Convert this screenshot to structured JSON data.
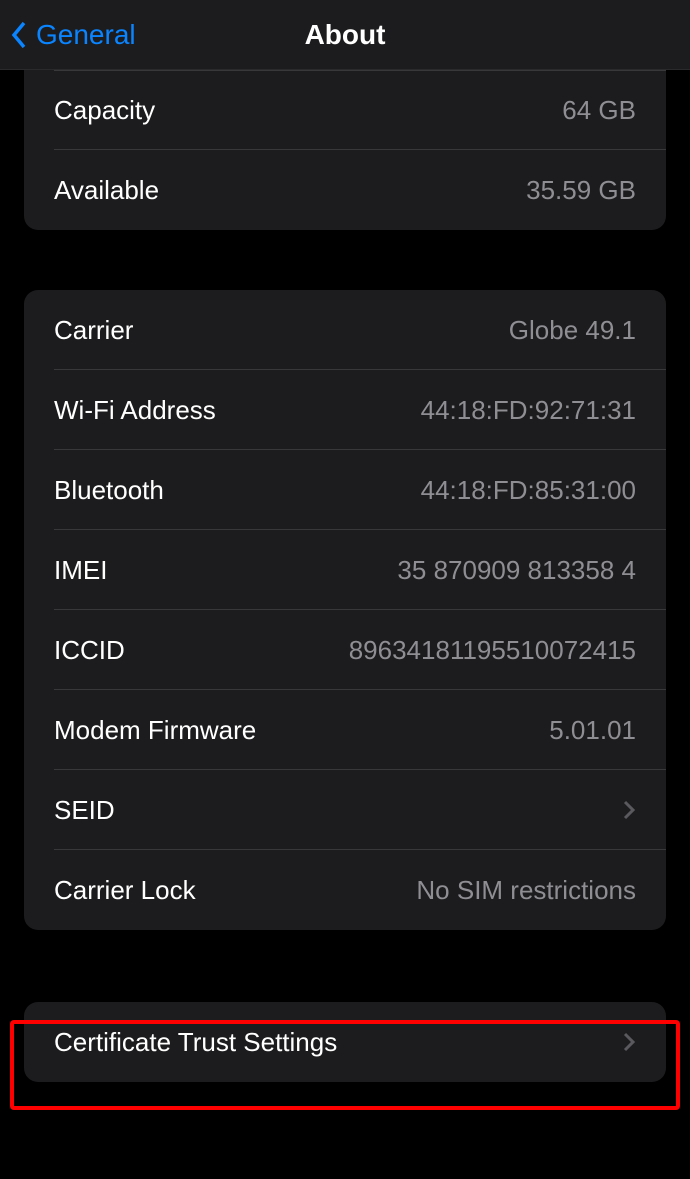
{
  "nav": {
    "back_label": "General",
    "title": "About"
  },
  "storage": {
    "capacity_label": "Capacity",
    "capacity_value": "64 GB",
    "available_label": "Available",
    "available_value": "35.59 GB"
  },
  "network": {
    "carrier_label": "Carrier",
    "carrier_value": "Globe 49.1",
    "wifi_label": "Wi-Fi Address",
    "wifi_value": "44:18:FD:92:71:31",
    "bluetooth_label": "Bluetooth",
    "bluetooth_value": "44:18:FD:85:31:00",
    "imei_label": "IMEI",
    "imei_value": "35 870909 813358 4",
    "iccid_label": "ICCID",
    "iccid_value": "89634181195510072415",
    "modem_label": "Modem Firmware",
    "modem_value": "5.01.01",
    "seid_label": "SEID",
    "carrier_lock_label": "Carrier Lock",
    "carrier_lock_value": "No SIM restrictions"
  },
  "cert": {
    "label": "Certificate Trust Settings"
  }
}
